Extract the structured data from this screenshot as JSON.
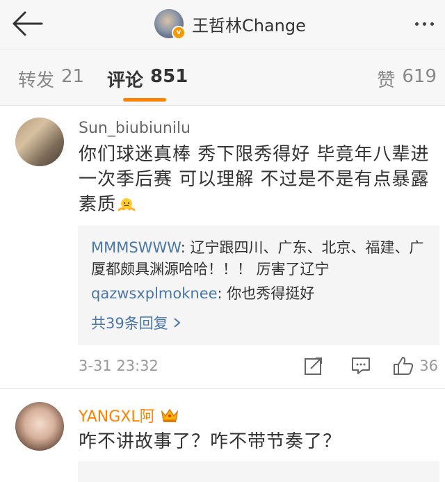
{
  "header": {
    "title": "王哲林Change",
    "back_icon": "back-arrow-icon",
    "more_icon": "more-icon",
    "badge_color": "#f29a00"
  },
  "tabs": {
    "repost": {
      "label": "转发",
      "count": "21"
    },
    "comments": {
      "label": "评论",
      "count": "851"
    },
    "likes": {
      "label": "赞",
      "count": "619"
    },
    "accent": "#ff8200"
  },
  "comments": [
    {
      "username": "Sun_biubiunilu",
      "text": "你们球迷真棒  秀下限秀得好  毕竟年八辈进一次季后赛  可以理解  不过是不是有点暴露素质",
      "emoji": "shrug-emoji",
      "replies": [
        {
          "name": "MMMSWWW",
          "text": ": 辽宁跟四川、广东、北京、福建、广厦都颇具渊源哈哈！！！ 厉害了辽宁"
        },
        {
          "name": "qazwsxplmoknee",
          "text": ": 你也秀得挺好"
        }
      ],
      "view_more": "共39条回复",
      "time": "3-31 23:32",
      "like_count": "36"
    },
    {
      "username": "YANGXL阿",
      "badge": "crown-icon",
      "text": "咋不讲故事了？咋不带节奏了？"
    }
  ]
}
